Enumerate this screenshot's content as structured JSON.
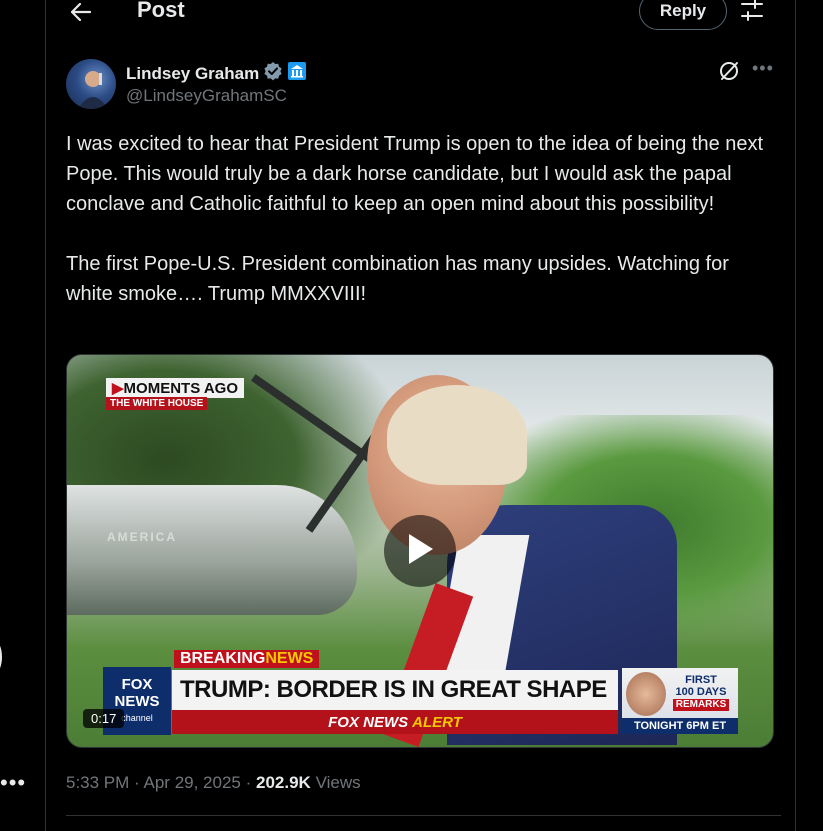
{
  "header": {
    "title": "Post",
    "reply_label": "Reply"
  },
  "author": {
    "name": "Lindsey Graham",
    "handle": "@LindseyGrahamSC",
    "verified_icon": "verified-badge-icon",
    "affiliation_icon": "government-building-icon"
  },
  "tweet": {
    "text": "I was excited to hear that President Trump is open to the idea of being the next Pope. This would truly be a dark horse candidate, but I would ask the papal conclave and Catholic faithful to keep an open mind about this possibility!\n\nThe first Pope-U.S. President combination has many upsides. Watching for white smoke…. Trump MMXXVIII!"
  },
  "media": {
    "moments_label": "MOMENTS AGO",
    "moments_arrow": "▶",
    "location_label": "THE WHITE HOUSE",
    "heli_text": "AMERICA",
    "breaking_label": "BREAKING",
    "news_label": "NEWS",
    "headline": "TRUMP: BORDER IS IN GREAT SHAPE",
    "alert_brand": "FOX NEWS",
    "alert_word": "ALERT",
    "fox_logo_line1": "FOX",
    "fox_logo_line2": "NEWS",
    "fox_logo_line3": "channel",
    "first100_line1": "FIRST",
    "first100_line2": "100 DAYS",
    "first100_remarks": "REMARKS",
    "first100_tonight": "TONIGHT 6PM ET",
    "duration": "0:17"
  },
  "meta": {
    "time": "5:33 PM",
    "sep1": "·",
    "date": "Apr 29, 2025",
    "sep2": "·",
    "views_count": "202.9K",
    "views_label": "Views"
  },
  "left_rail": {
    "more_dots": "•••"
  },
  "colors": {
    "background": "#000000",
    "text": "#e7e9ea",
    "muted": "#71767b",
    "border": "#2f3336",
    "verified": "#829aab",
    "affiliation": "#1d9bf0"
  }
}
